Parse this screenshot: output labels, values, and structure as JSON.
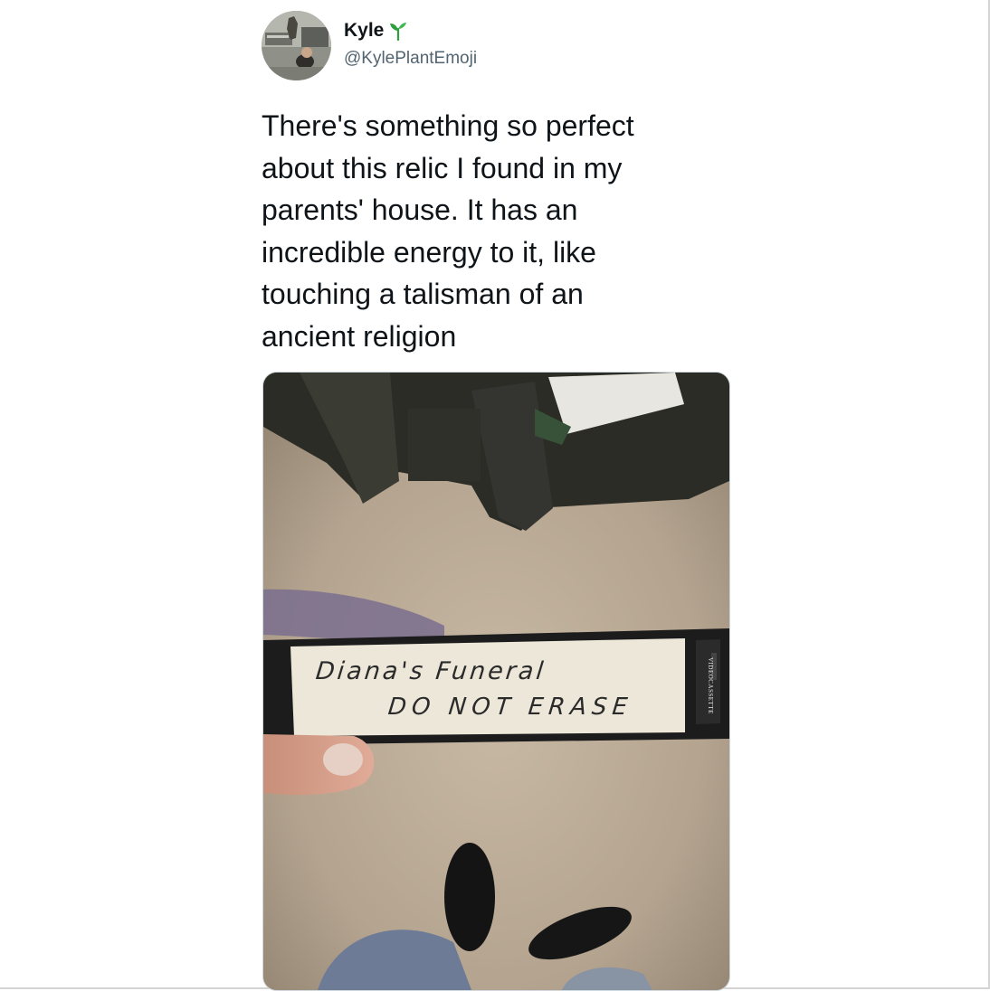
{
  "author": {
    "name": "Kyle",
    "badge_icon": "sprout-emoji",
    "handle": "@KylePlantEmoji"
  },
  "tweet": {
    "text": "There's something so perfect\nabout this relic I found in my\nparents' house. It has an\nincredible energy to it, like\ntouching a talisman of an\nancient religion"
  },
  "media": {
    "label_line1": "Diana's Funeral",
    "label_line2": "DO NOT ERASE",
    "spine_text": "VIDEOCASSETTE"
  },
  "colors": {
    "text": "#0f1419",
    "secondary": "#536471",
    "sprout": "#2e9e3e"
  }
}
